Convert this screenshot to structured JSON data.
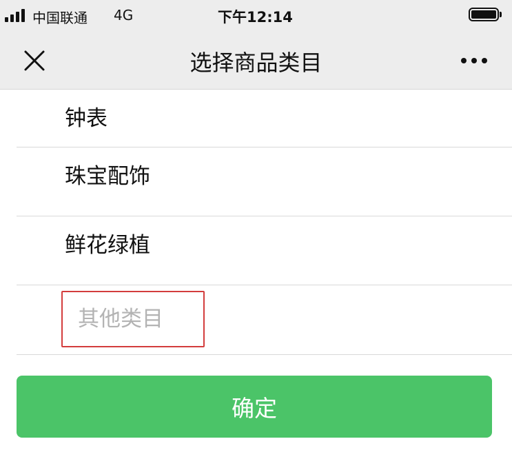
{
  "status_bar": {
    "carrier": "中国联通",
    "network": "4G",
    "time": "下午12:14"
  },
  "nav_bar": {
    "title": "选择商品类目",
    "left_icon": "close-icon",
    "right_icon": "more-icon"
  },
  "categories": [
    {
      "label": "钟表"
    },
    {
      "label": "珠宝配饰"
    },
    {
      "label": "鲜花绿植"
    }
  ],
  "other_category": {
    "placeholder": "其他类目",
    "value": "",
    "highlight_color": "#d33c3c"
  },
  "confirm_button": {
    "label": "确定",
    "color": "#4bc468"
  }
}
